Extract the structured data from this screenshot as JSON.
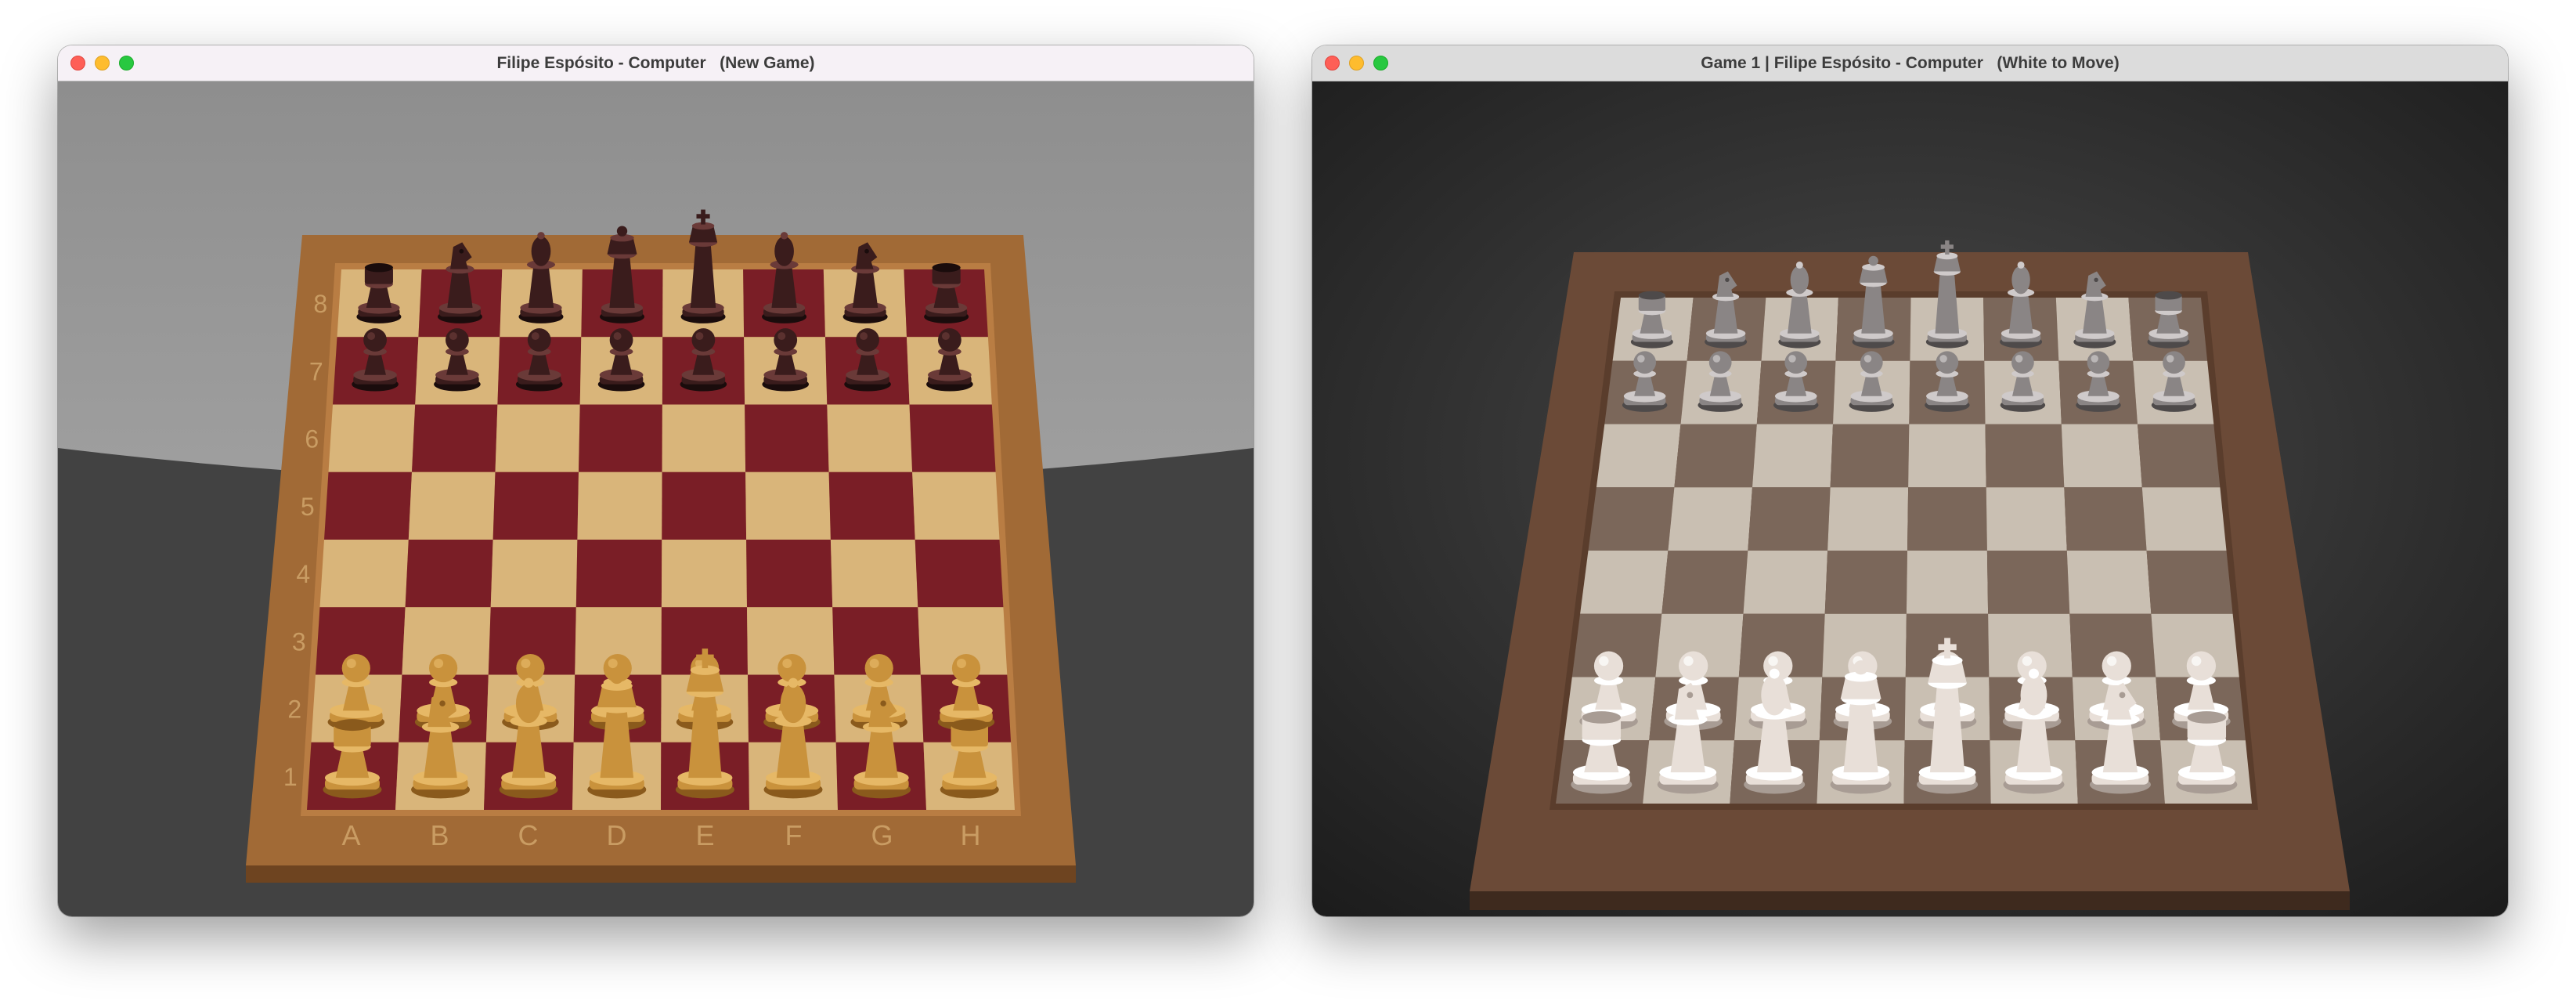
{
  "windows": [
    {
      "title": "Filipe Espósito - Computer   (New Game)",
      "board_style": "wood",
      "file_labels": [
        "A",
        "B",
        "C",
        "D",
        "E",
        "F",
        "G",
        "H"
      ],
      "rank_labels": [
        "8",
        "7",
        "6",
        "5",
        "4",
        "3",
        "2",
        "1"
      ],
      "colors": {
        "light_square": "#d9b57a",
        "dark_square": "#7a1e26",
        "frame": "#a16a36",
        "white_pieces": "#c9923c",
        "black_pieces": "#3a1c1c"
      }
    },
    {
      "title": "Game 1 | Filipe Espósito - Computer   (White to Move)",
      "board_style": "marble",
      "colors": {
        "light_square": "#c9bfb2",
        "dark_square": "#7b675a",
        "frame": "#6b4a37",
        "white_pieces": "#e8dfd8",
        "black_pieces": "#8a8585"
      }
    }
  ],
  "position": {
    "rank8": [
      "rook",
      "knight",
      "bishop",
      "queen",
      "king",
      "bishop",
      "knight",
      "rook"
    ],
    "rank7": [
      "pawn",
      "pawn",
      "pawn",
      "pawn",
      "pawn",
      "pawn",
      "pawn",
      "pawn"
    ],
    "rank2": [
      "pawn",
      "pawn",
      "pawn",
      "pawn",
      "pawn",
      "pawn",
      "pawn",
      "pawn"
    ],
    "rank1": [
      "rook",
      "knight",
      "bishop",
      "queen",
      "king",
      "bishop",
      "knight",
      "rook"
    ]
  }
}
